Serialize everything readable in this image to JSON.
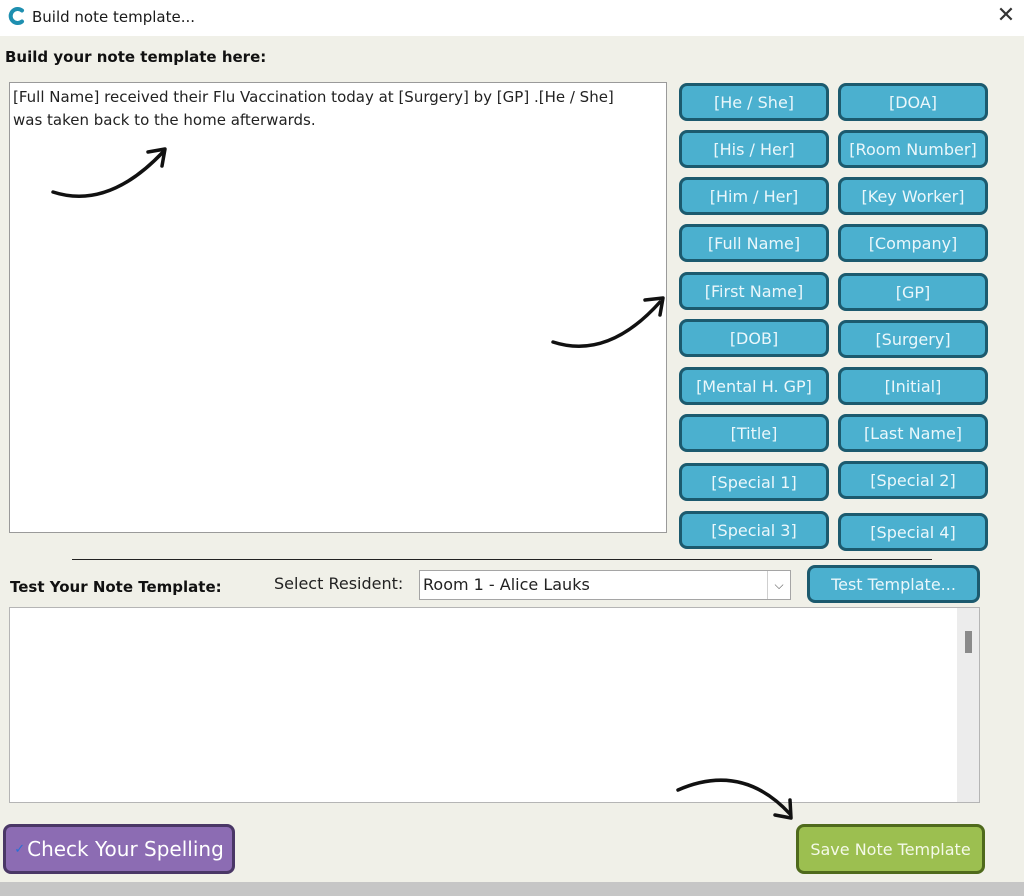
{
  "window": {
    "title": "Build note template...",
    "close": "✕"
  },
  "builder": {
    "label": "Build your note template here:",
    "template_text": "[Full Name] received their Flu Vaccination today at [Surgery] by [GP] .[He / She]\nwas taken back to the home afterwards."
  },
  "tokens": {
    "left": [
      "[He / She]",
      "[His / Her]",
      "[Him / Her]",
      "[Full Name]",
      "[First Name]",
      "[DOB]",
      "[Mental H. GP]",
      "[Title]",
      "[Special 1]",
      "[Special 3]"
    ],
    "right": [
      "[DOA]",
      "[Room Number]",
      "[Key Worker]",
      "[Company]",
      "[GP]",
      "[Surgery]",
      "[Initial]",
      "[Last Name]",
      "[Special 2]",
      "[Special 4]"
    ]
  },
  "test": {
    "label": "Test Your Note Template:",
    "resident_label": "Select Resident:",
    "resident_value": "Room 1 - Alice Lauks",
    "test_button": "Test Template...",
    "output_text": ""
  },
  "footer": {
    "spell_button": "Check Your Spelling",
    "save_button": "Save Note Template"
  },
  "colors": {
    "token_button": "#4bb0cf",
    "spell_button": "#8c6cb3",
    "save_button": "#9cbf50"
  }
}
